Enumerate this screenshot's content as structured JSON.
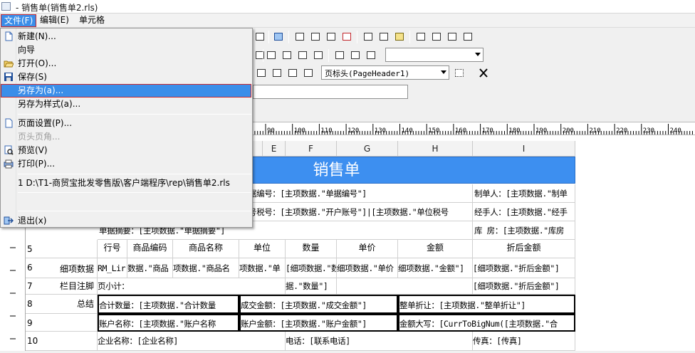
{
  "window": {
    "title": "- 销售单(销售单2.rls)"
  },
  "menubar": {
    "file": "文件(F)",
    "edit": "编辑(E)",
    "cell": "单元格"
  },
  "file_menu": {
    "items": [
      {
        "label": "新建(N)...",
        "icon": "new-file-icon"
      },
      {
        "label": "向导",
        "icon": ""
      },
      {
        "label": "打开(O)...",
        "icon": "open-folder-icon"
      },
      {
        "label": "保存(S)",
        "icon": "save-disk-icon"
      },
      {
        "label": "另存为(a)...",
        "icon": ""
      },
      {
        "label": "另存为样式(a)...",
        "icon": ""
      },
      {
        "label": "页面设置(P)...",
        "icon": "page-setup-icon"
      },
      {
        "label": "页头页角...",
        "icon": ""
      },
      {
        "label": "预览(V)",
        "icon": "preview-icon"
      },
      {
        "label": "打印(P)...",
        "icon": "printer-icon"
      },
      {
        "label": "1 D:\\T1-商贸宝批发零售版\\客户端程序\\rep\\销售单2.rls",
        "icon": ""
      },
      {
        "label": "退出(x)",
        "icon": "exit-icon"
      }
    ],
    "selected_index": 4,
    "disabled": [
      "页头页角..."
    ]
  },
  "toolbar": {
    "band_select": "页标头(PageHeader1)"
  },
  "ruler": {
    "ticks": [
      "90",
      "100",
      "110",
      "120",
      "130",
      "140",
      "150",
      "160",
      "170",
      "180",
      "190",
      "200",
      "210",
      "220",
      "230",
      "240"
    ]
  },
  "columns": [
    "E",
    "F",
    "G",
    "H",
    "I"
  ],
  "sheet": {
    "title": "销售单",
    "rows": [
      {
        "num": "",
        "label": "",
        "cells": [
          "据编号：[主项数据.\"单据编号\"]",
          "制单人：[主项数据.\"制单"
        ]
      },
      {
        "num": "",
        "label": "",
        "cells": [
          "号税号：[主项数据.\"开户账号\"]|[主项数据.\"单位税号",
          "经手人：[主项数据.\"经手"
        ]
      },
      {
        "num": "",
        "label": "",
        "cells": [
          "单据摘要：[主项数据.\"单据摘要\"]",
          "库  房：[主项数据.\"库房"
        ]
      },
      {
        "num": "5",
        "label": "",
        "cells": [
          "行号",
          "商品编码",
          "商品名称",
          "单位",
          "数量",
          "单价",
          "金额",
          "折后金额"
        ]
      },
      {
        "num": "6",
        "label": "细项数据",
        "cells": [
          "RM_Lir",
          "数据.\"商品",
          "项数据.\"商品名",
          "项数据.\"单",
          "[细项数据.\"数量\"]",
          "细项数据.\"单价",
          "细项数据.\"金额\"]",
          "[细项数据.\"折后金额\"]"
        ]
      },
      {
        "num": "7",
        "label": "栏目注脚",
        "cells": [
          "页小计：",
          "据.\"数量\"]",
          "[细项数据.\"折后金额\"]"
        ]
      },
      {
        "num": "8",
        "label": "总结",
        "cells": [
          "合计数量：[主项数据.\"合计数量",
          "成交金额：[主项数据.\"成交金额\"]",
          "整单折让：[主项数据.\"整单折让\"]"
        ]
      },
      {
        "num": "9",
        "label": "",
        "cells": [
          "账户名称：[主项数据.\"账户名称",
          "账户金额：[主项数据.\"账户金额\"]",
          "金额大写：[CurrToBigNum([主项数据.\"合"
        ]
      },
      {
        "num": "10",
        "label": "",
        "cells": [
          "企业名称：[企业名称]",
          "电话：[联系电话]",
          "传真：[传真]"
        ]
      }
    ]
  },
  "colors": {
    "menu_highlight": "#3b8ee9",
    "title_band": "#3d8ff0",
    "selection_border": "#c5262c"
  }
}
